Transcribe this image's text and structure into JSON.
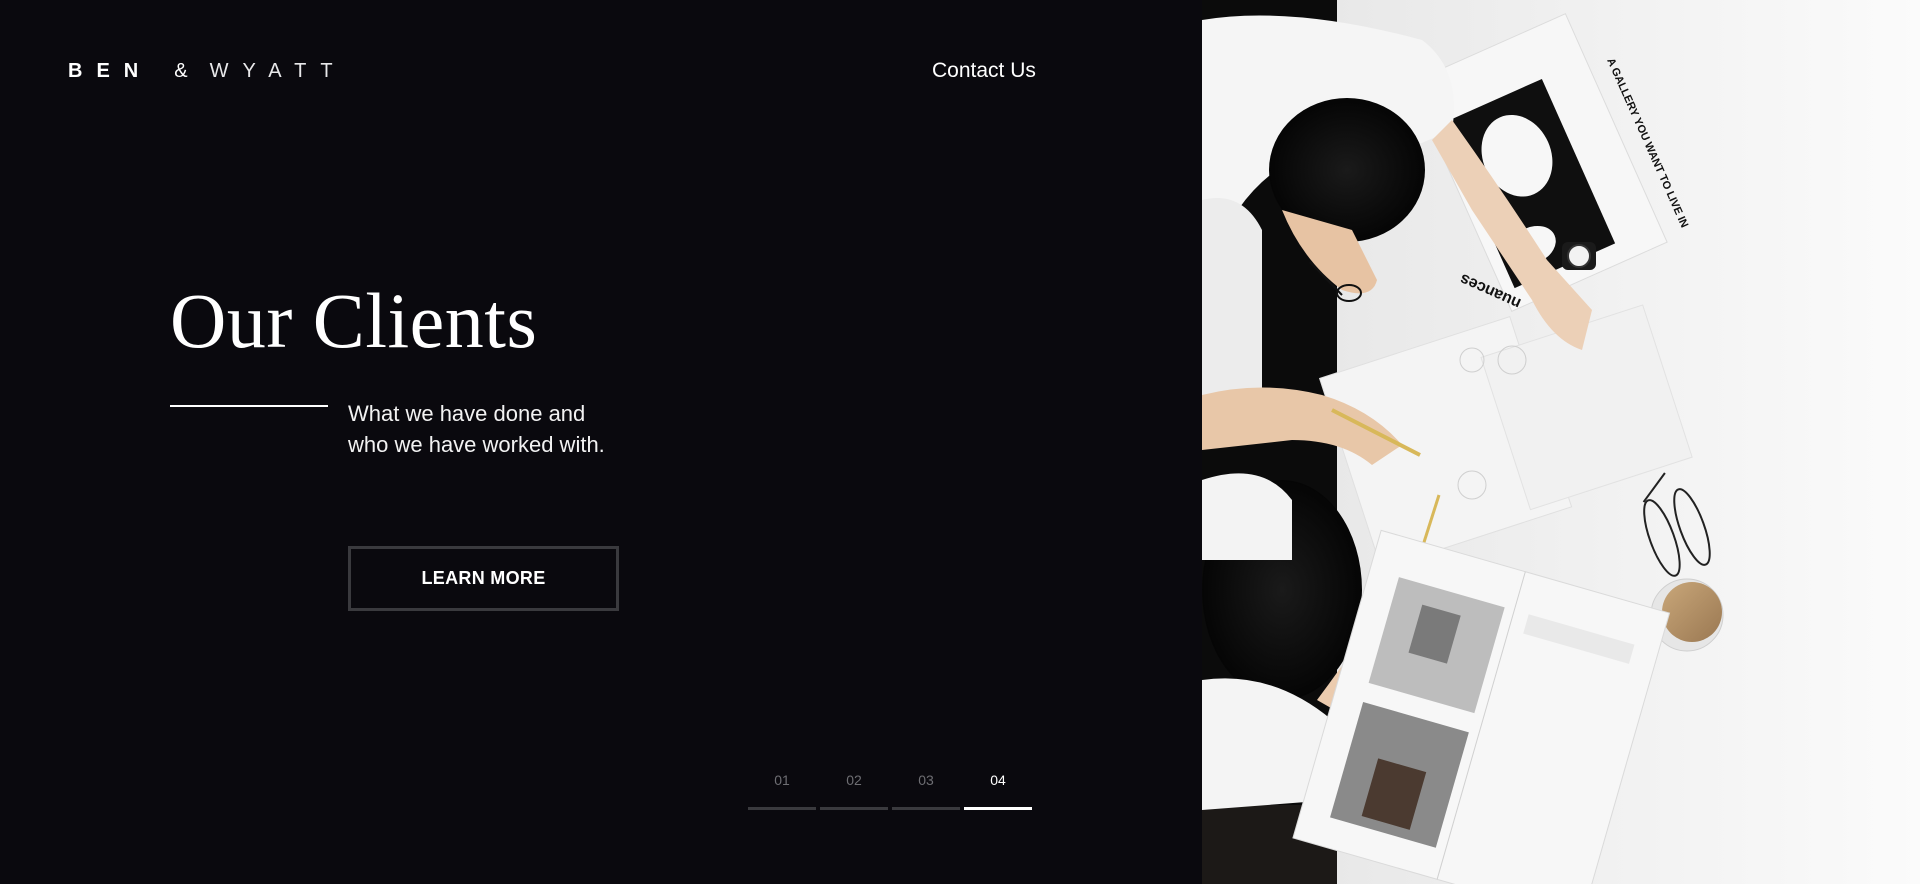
{
  "header": {
    "logo": {
      "part1": "BEN",
      "amp": "&",
      "part2": "WYATT"
    },
    "contact_label": "Contact Us"
  },
  "hero": {
    "title": "Our Clients",
    "subtitle_line1": "What we have done and",
    "subtitle_line2": "who we have worked with.",
    "cta_label": "LEARN MORE"
  },
  "pager": {
    "items": [
      "01",
      "02",
      "03",
      "04"
    ],
    "active_index": 3
  },
  "photo": {
    "magazine_text": "A GALLERY YOU WANT TO LIVE IN",
    "magazine_brand": "nuances"
  },
  "colors": {
    "background": "#0a090e",
    "text": "#ffffff",
    "muted": "#6e6e73",
    "border": "#3a3a3e"
  }
}
